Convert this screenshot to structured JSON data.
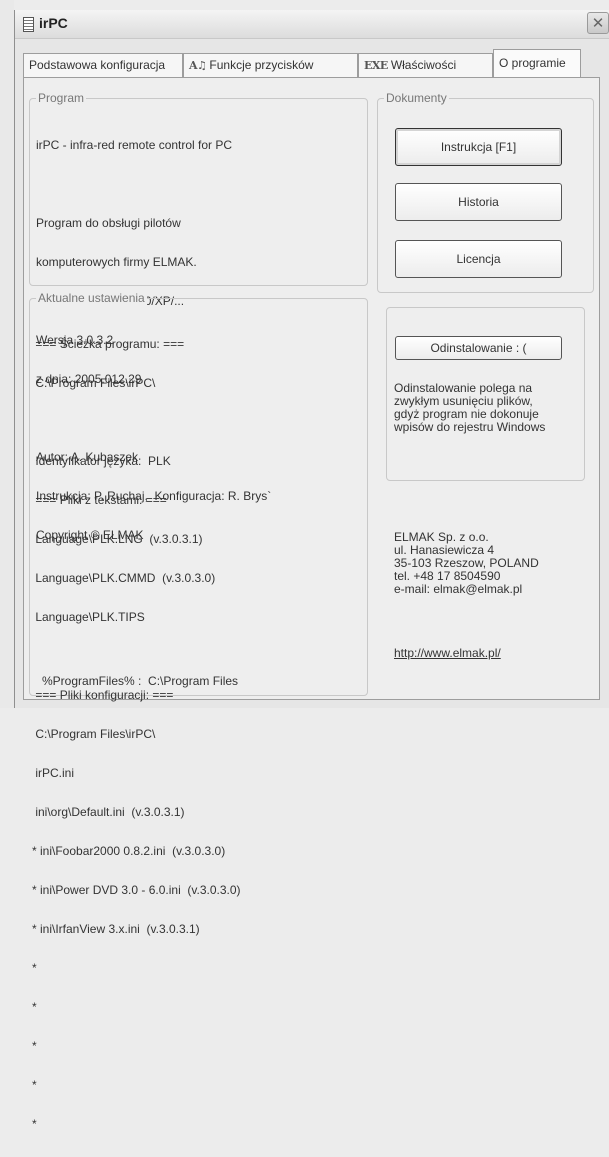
{
  "window": {
    "title": "irPC",
    "close_symbol": "✕"
  },
  "tabs": [
    {
      "label": "Podstawowa konfiguracja",
      "glyph": ""
    },
    {
      "label": "Funkcje przycisków",
      "glyph": "A♫"
    },
    {
      "label": "Właściwości",
      "glyph": "EXE"
    },
    {
      "label": "O programie",
      "glyph": ""
    }
  ],
  "program": {
    "title": "Program",
    "lines": [
      "irPC - infra-red remote control for PC",
      "",
      "Program do obsługi pilotów",
      "komputerowych firmy ELMAK.",
      "Windows 98/Me/2000/XP/...",
      "Wersja 3.0.3.2",
      "z dnia: 2005.012.29",
      "",
      "Autor: A. Kubaszek",
      "Instrukcja: P. Ruchaj,  Konfiguracja: R. Brys`",
      "Copyright © ELMAK"
    ]
  },
  "settings": {
    "title": "Aktualne ustawienia",
    "lines": [
      " === Ścieżka programu: ===",
      " C:\\Program Files\\irPC\\",
      "",
      " Identyfikator języka:  PLK",
      " === Pliki z tekstami: ===",
      " Language\\PLK.LNG  (v.3.0.3.1)",
      " Language\\PLK.CMMD  (v.3.0.3.0)",
      " Language\\PLK.TIPS",
      "",
      " === Pliki konfiguracji: ===",
      " C:\\Program Files\\irPC\\",
      " irPC.ini",
      " ini\\org\\Default.ini  (v.3.0.3.1)",
      "* ini\\Foobar2000 0.8.2.ini  (v.3.0.3.0)",
      "* ini\\Power DVD 3.0 - 6.0.ini  (v.3.0.3.0)",
      "* ini\\IrfanView 3.x.ini  (v.3.0.3.1)",
      "*",
      "*",
      "*",
      "*",
      "*"
    ],
    "footer": "%ProgramFiles% :  C:\\Program Files"
  },
  "documents": {
    "title": "Dokumenty",
    "instrukcja": "Instrukcja  [F1]",
    "historia": "Historia",
    "licencja": "Licencja"
  },
  "uninstall": {
    "button": "Odinstalowanie  : (",
    "description": "Odinstalowanie polega na\nzwykłym usunięciu plików,\ngdyż program nie dokonuje\nwpisów do rejestru Windows"
  },
  "company": {
    "lines": [
      "ELMAK Sp. z o.o.",
      "ul. Hanasiewicza 4",
      "35-103 Rzeszow, POLAND",
      "tel. +48 17 8504590",
      "e-mail: elmak@elmak.pl"
    ],
    "website": "http://www.elmak.pl/"
  }
}
